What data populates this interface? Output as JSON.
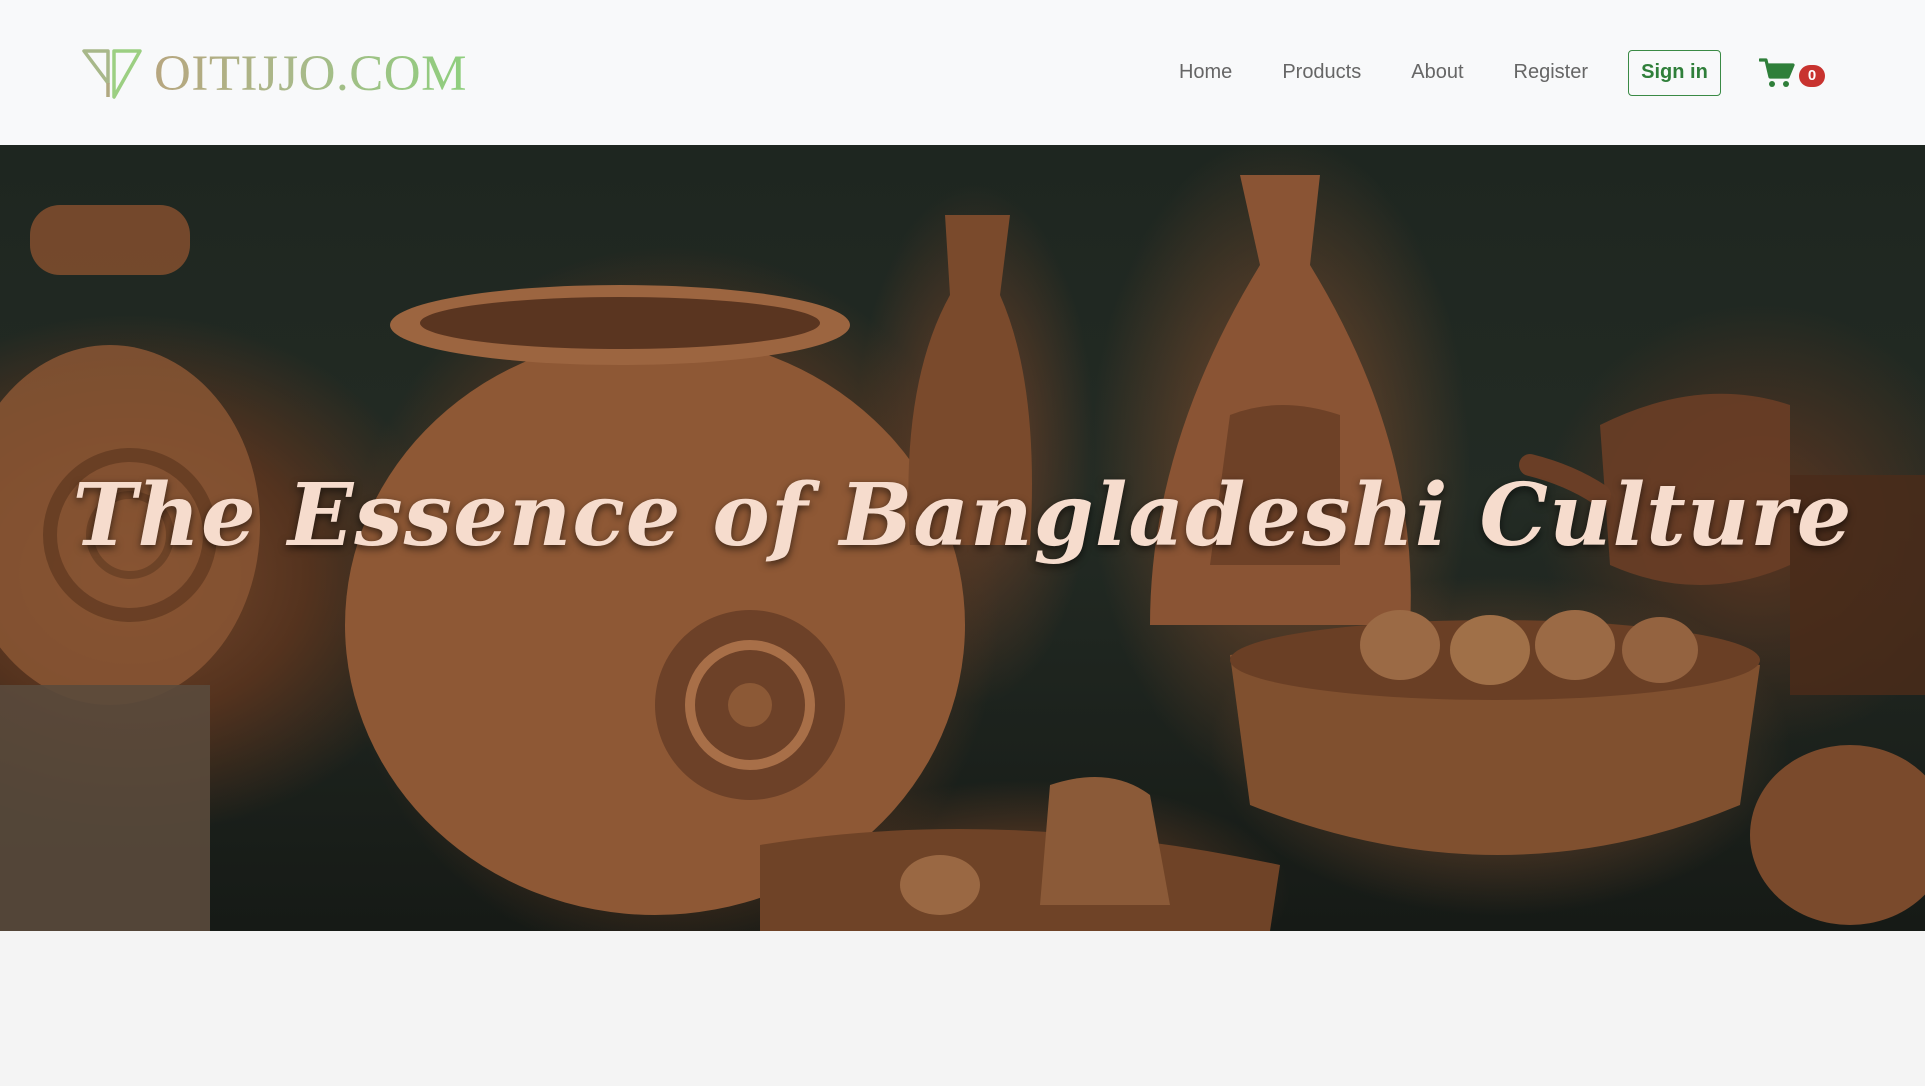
{
  "brand": {
    "name": "OITIJJO.COM"
  },
  "nav": {
    "links": [
      "Home",
      "Products",
      "About",
      "Register"
    ],
    "signin_label": "Sign in",
    "cart_count": "0"
  },
  "hero": {
    "title": "The Essence of Bangladeshi Culture"
  },
  "colors": {
    "brand_gradient_start": "#b7a67f",
    "brand_gradient_end": "#8fcf7e",
    "accent_green": "#2f7f3a",
    "badge_red": "#c8332f",
    "hero_title": "#f6dccd"
  },
  "icons": {
    "brand_mark": "logo-mark-icon",
    "cart": "shopping-cart-icon"
  }
}
